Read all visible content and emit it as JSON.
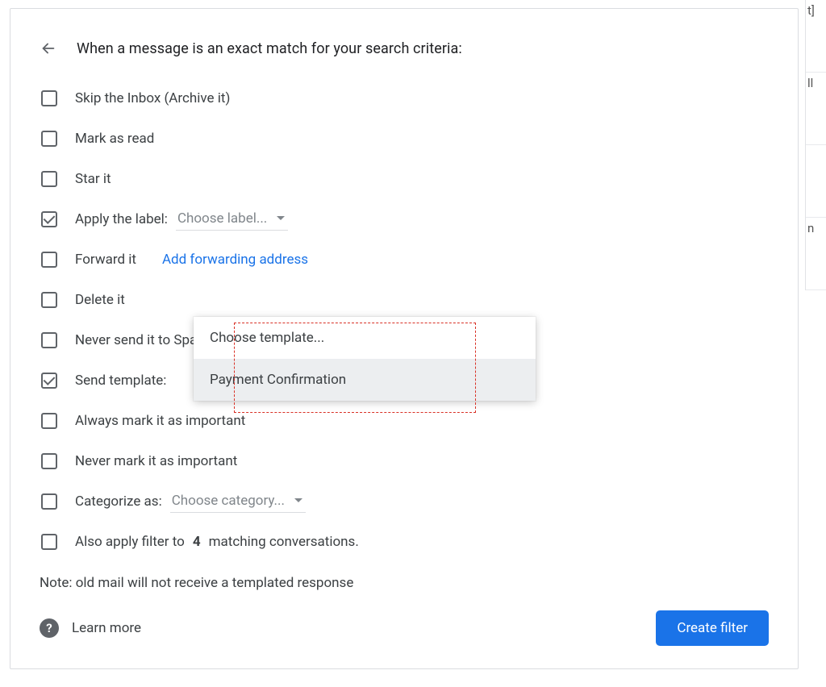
{
  "background_snippets": [
    "t]",
    "ll",
    "",
    "n"
  ],
  "header": {
    "title": "When a message is an exact match for your search criteria:"
  },
  "options": {
    "skip_inbox": {
      "label": "Skip the Inbox (Archive it)",
      "checked": false
    },
    "mark_read": {
      "label": "Mark as read",
      "checked": false
    },
    "star": {
      "label": "Star it",
      "checked": false
    },
    "apply_label": {
      "label_prefix": "Apply the label:",
      "select_text": "Choose label...",
      "checked": true
    },
    "forward": {
      "label": "Forward it",
      "link": "Add forwarding address",
      "checked": false
    },
    "delete": {
      "label": "Delete it",
      "checked": false
    },
    "never_spam": {
      "label": "Never send it to Spam",
      "checked": false
    },
    "send_template": {
      "label_prefix": "Send template:",
      "checked": true
    },
    "always_important": {
      "label": "Always mark it as important",
      "checked": false
    },
    "never_important": {
      "label": "Never mark it as important",
      "checked": false
    },
    "categorize": {
      "label_prefix": "Categorize as:",
      "select_text": "Choose category...",
      "checked": false
    },
    "also_apply": {
      "prefix": "Also apply filter to ",
      "count": "4",
      "suffix": " matching conversations.",
      "checked": false
    }
  },
  "template_menu": {
    "choose": "Choose template...",
    "item1": "Payment Confirmation"
  },
  "note": "Note: old mail will not receive a templated response",
  "footer": {
    "learn_more": "Learn more",
    "create_filter": "Create filter"
  }
}
